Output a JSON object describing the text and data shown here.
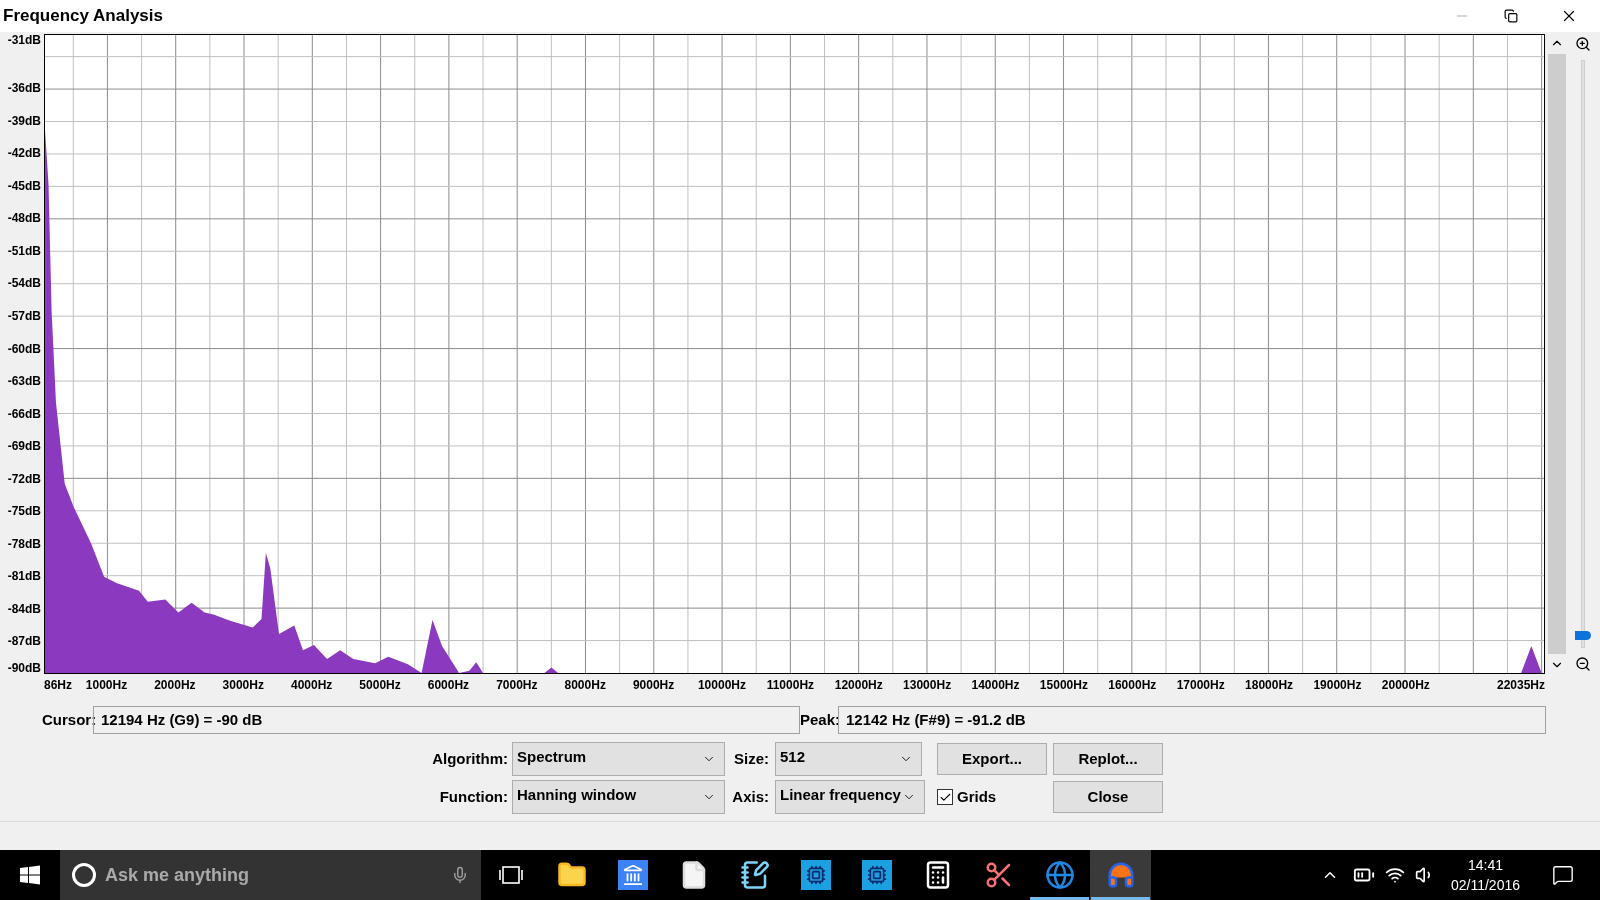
{
  "window": {
    "title": "Frequency Analysis"
  },
  "chart": {
    "chart_data": {
      "type": "area",
      "xlim": [
        86,
        22035
      ],
      "ylim": [
        -90,
        -31
      ],
      "xticks": [
        {
          "value": 86,
          "label": "86Hz"
        },
        {
          "value": 1000,
          "label": "1000Hz"
        },
        {
          "value": 2000,
          "label": "2000Hz"
        },
        {
          "value": 3000,
          "label": "3000Hz"
        },
        {
          "value": 4000,
          "label": "4000Hz"
        },
        {
          "value": 5000,
          "label": "5000Hz"
        },
        {
          "value": 6000,
          "label": "6000Hz"
        },
        {
          "value": 7000,
          "label": "7000Hz"
        },
        {
          "value": 8000,
          "label": "8000Hz"
        },
        {
          "value": 9000,
          "label": "9000Hz"
        },
        {
          "value": 10000,
          "label": "10000Hz"
        },
        {
          "value": 11000,
          "label": "11000Hz"
        },
        {
          "value": 12000,
          "label": "12000Hz"
        },
        {
          "value": 13000,
          "label": "13000Hz"
        },
        {
          "value": 14000,
          "label": "14000Hz"
        },
        {
          "value": 15000,
          "label": "15000Hz"
        },
        {
          "value": 16000,
          "label": "16000Hz"
        },
        {
          "value": 17000,
          "label": "17000Hz"
        },
        {
          "value": 18000,
          "label": "18000Hz"
        },
        {
          "value": 19000,
          "label": "19000Hz"
        },
        {
          "value": 20000,
          "label": "20000Hz"
        },
        {
          "value": 22035,
          "label": "22035Hz"
        }
      ],
      "yticks": [
        {
          "value": -31,
          "label": "-31dB"
        },
        {
          "value": -36,
          "label": "-36dB"
        },
        {
          "value": -39,
          "label": "-39dB"
        },
        {
          "value": -42,
          "label": "-42dB"
        },
        {
          "value": -45,
          "label": "-45dB"
        },
        {
          "value": -48,
          "label": "-48dB"
        },
        {
          "value": -51,
          "label": "-51dB"
        },
        {
          "value": -54,
          "label": "-54dB"
        },
        {
          "value": -57,
          "label": "-57dB"
        },
        {
          "value": -60,
          "label": "-60dB"
        },
        {
          "value": -63,
          "label": "-63dB"
        },
        {
          "value": -66,
          "label": "-66dB"
        },
        {
          "value": -69,
          "label": "-69dB"
        },
        {
          "value": -72,
          "label": "-72dB"
        },
        {
          "value": -75,
          "label": "-75dB"
        },
        {
          "value": -78,
          "label": "-78dB"
        },
        {
          "value": -81,
          "label": "-81dB"
        },
        {
          "value": -84,
          "label": "-84dB"
        },
        {
          "value": -87,
          "label": "-87dB"
        },
        {
          "value": -90,
          "label": "-90dB"
        }
      ],
      "grid": true,
      "x": [
        86,
        87,
        138,
        183,
        247,
        375,
        503,
        760,
        951,
        1141,
        1463,
        1591,
        1847,
        2040,
        2232,
        2424,
        2552,
        2808,
        3128,
        3256,
        3320,
        3384,
        3512,
        3736,
        3864,
        4024,
        4216,
        4408,
        4600,
        4920,
        5112,
        5400,
        5600,
        5760,
        5900,
        6150,
        6300,
        6400,
        6500,
        7000,
        7400,
        7500,
        7600,
        10000,
        15000,
        21700,
        21850,
        22000,
        22035
      ],
      "series": [
        {
          "color": "#8b3ac0",
          "values": [
            -90,
            -39.8,
            -44.9,
            -56.6,
            -65,
            -72.5,
            -74.6,
            -78,
            -81.1,
            -81.7,
            -82.4,
            -83.4,
            -83.2,
            -84.4,
            -83.5,
            -84.4,
            -84.6,
            -85.2,
            -85.8,
            -85,
            -78.9,
            -80.3,
            -86.4,
            -85.6,
            -87.9,
            -87.4,
            -88.7,
            -87.9,
            -88.7,
            -89.1,
            -88.5,
            -89.2,
            -90,
            -85.1,
            -87.5,
            -90,
            -89.8,
            -89,
            -90,
            -90,
            -90,
            -89.5,
            -90,
            -90,
            -90,
            -90,
            -87.5,
            -90,
            -90
          ]
        }
      ]
    }
  },
  "zoom_slider": {
    "level": 0.02
  },
  "cursor": {
    "label": "Cursor:",
    "value": "12194 Hz (G9) = -90 dB"
  },
  "peak": {
    "label": "Peak:",
    "value": "12142 Hz (F#9) = -91.2 dB"
  },
  "algorithm": {
    "label": "Algorithm:",
    "value": "Spectrum"
  },
  "size": {
    "label": "Size:",
    "value": "512"
  },
  "function": {
    "label": "Function:",
    "value": "Hanning window"
  },
  "axis": {
    "label": "Axis:",
    "value": "Linear frequency"
  },
  "grids": {
    "label": "Grids",
    "checked": true
  },
  "buttons": {
    "export": "Export...",
    "replot": "Replot...",
    "close": "Close"
  },
  "taskbar": {
    "search_placeholder": "Ask me anything",
    "apps": [
      {
        "kind": "folder",
        "running": false,
        "selected": false
      },
      {
        "kind": "building",
        "running": false,
        "selected": false
      },
      {
        "kind": "document",
        "running": false,
        "selected": false
      },
      {
        "kind": "notepad",
        "running": false,
        "selected": false
      },
      {
        "kind": "chip",
        "running": false,
        "selected": false
      },
      {
        "kind": "chip",
        "running": false,
        "selected": false
      },
      {
        "kind": "calculator",
        "running": false,
        "selected": false
      },
      {
        "kind": "scissors",
        "running": false,
        "selected": false
      },
      {
        "kind": "browser",
        "running": true,
        "selected": false
      },
      {
        "kind": "headphones",
        "running": true,
        "selected": true
      }
    ],
    "time": "14:41",
    "date": "02/11/2016"
  }
}
